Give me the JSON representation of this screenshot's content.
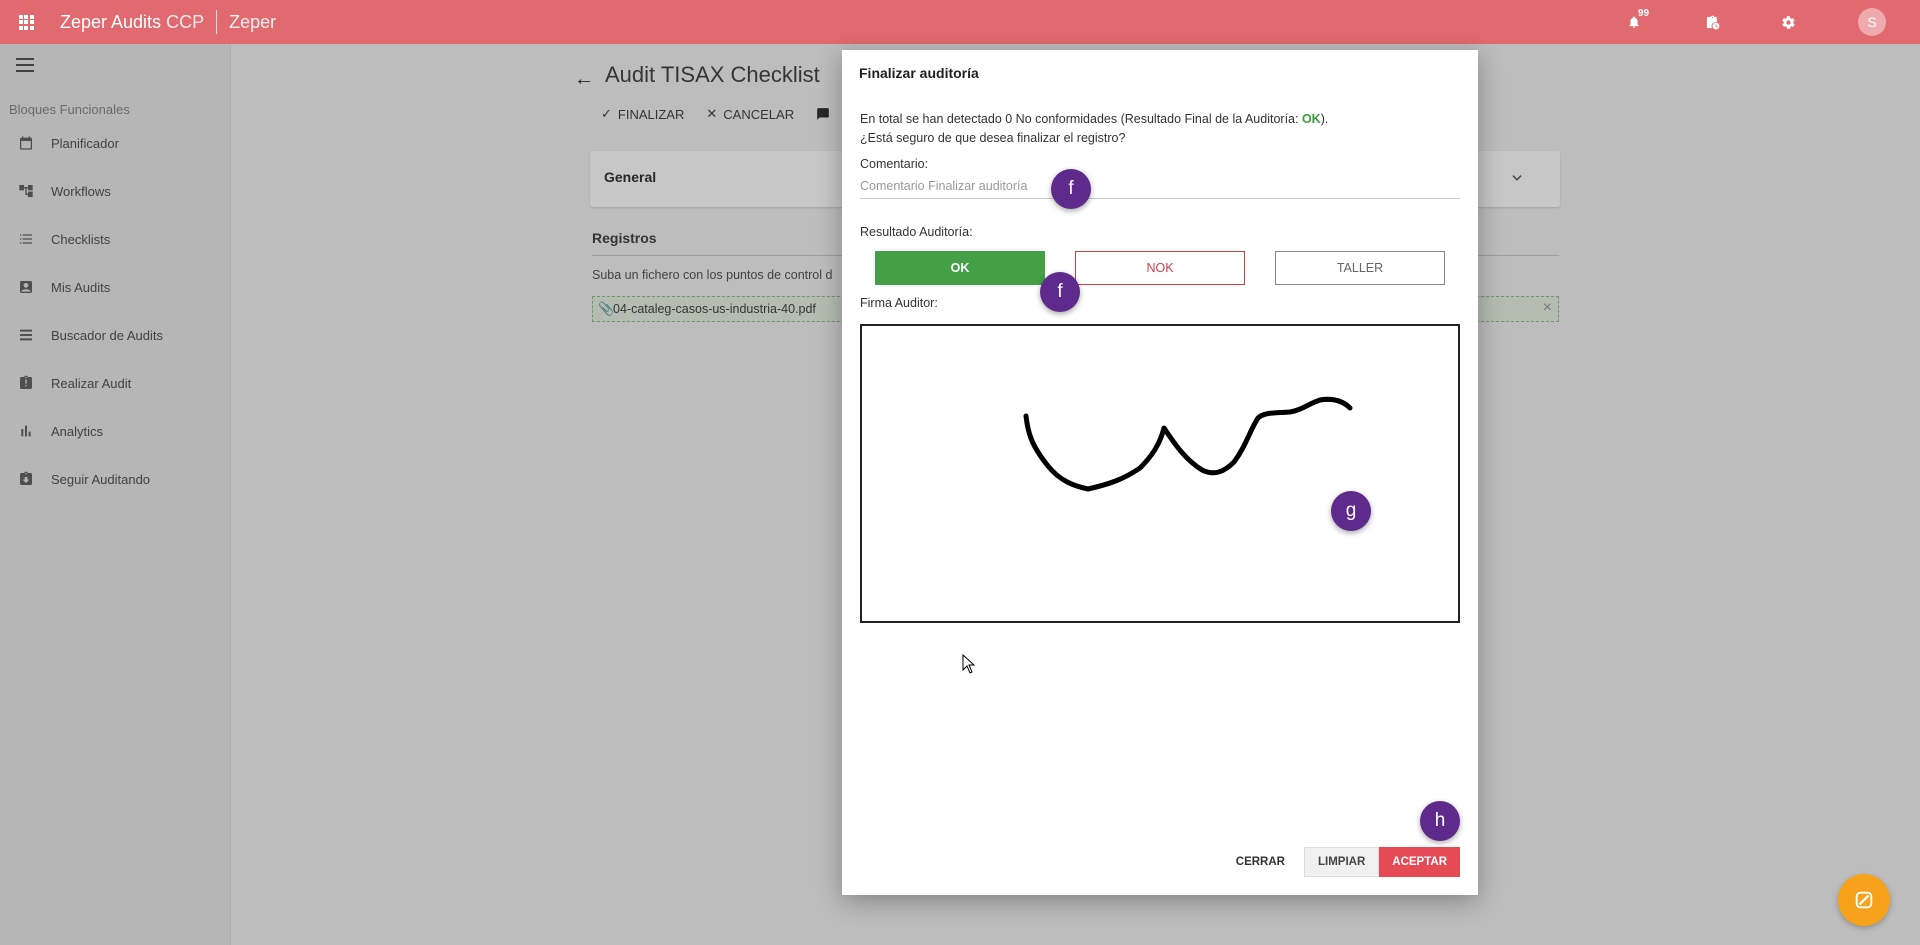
{
  "topbar": {
    "brand": "Zeper Audits",
    "brand_suffix": "CCP",
    "tenant": "Zeper",
    "notification_count": "99",
    "avatar_initial": "S"
  },
  "sidebar": {
    "section_title": "Bloques Funcionales",
    "items": [
      {
        "label": "Planificador",
        "icon": "calendar-icon"
      },
      {
        "label": "Workflows",
        "icon": "workflow-icon"
      },
      {
        "label": "Checklists",
        "icon": "list-icon"
      },
      {
        "label": "Mis Audits",
        "icon": "person-card-icon"
      },
      {
        "label": "Buscador de Audits",
        "icon": "list-search-icon"
      },
      {
        "label": "Realizar Audit",
        "icon": "clipboard-alert-icon"
      },
      {
        "label": "Analytics",
        "icon": "bar-chart-icon"
      },
      {
        "label": "Seguir Auditando",
        "icon": "clipboard-download-icon"
      }
    ]
  },
  "main": {
    "title": "Audit TISAX Checklist",
    "toolbar": {
      "finalizar": "FINALIZAR",
      "cancelar": "CANCELAR"
    },
    "general_card_title": "General",
    "registros_title": "Registros",
    "registros_desc": "Suba un fichero con los puntos de control d",
    "file_name": "04-cataleg-casos-us-industria-40.pdf"
  },
  "dialog": {
    "title": "Finalizar auditoría",
    "message_prefix": "En total se han detectado 0 No conformidades (Resultado Final de la Auditoría: ",
    "message_result": "OK",
    "message_suffix": ").",
    "question": "¿Está seguro de que desea finalizar el registro?",
    "comment_label": "Comentario:",
    "comment_placeholder": "Comentario Finalizar auditoría",
    "comment_value": "",
    "result_label": "Resultado Auditoría:",
    "result_options": [
      "OK",
      "NOK",
      "TALLER"
    ],
    "selected_result": "OK",
    "signature_label": "Firma Auditor:",
    "actions": {
      "cerrar": "CERRAR",
      "limpiar": "LIMPIAR",
      "aceptar": "ACEPTAR"
    }
  },
  "markers": {
    "comment": "f",
    "result": "f",
    "signature": "g",
    "accept": "h"
  },
  "colors": {
    "topbar": "#e06a6f",
    "ok_green": "#43a047",
    "nok_red": "#d93c47",
    "accept_red": "#e64a55",
    "marker_purple": "#5e2a8c",
    "fab_orange": "#f7a21b"
  }
}
